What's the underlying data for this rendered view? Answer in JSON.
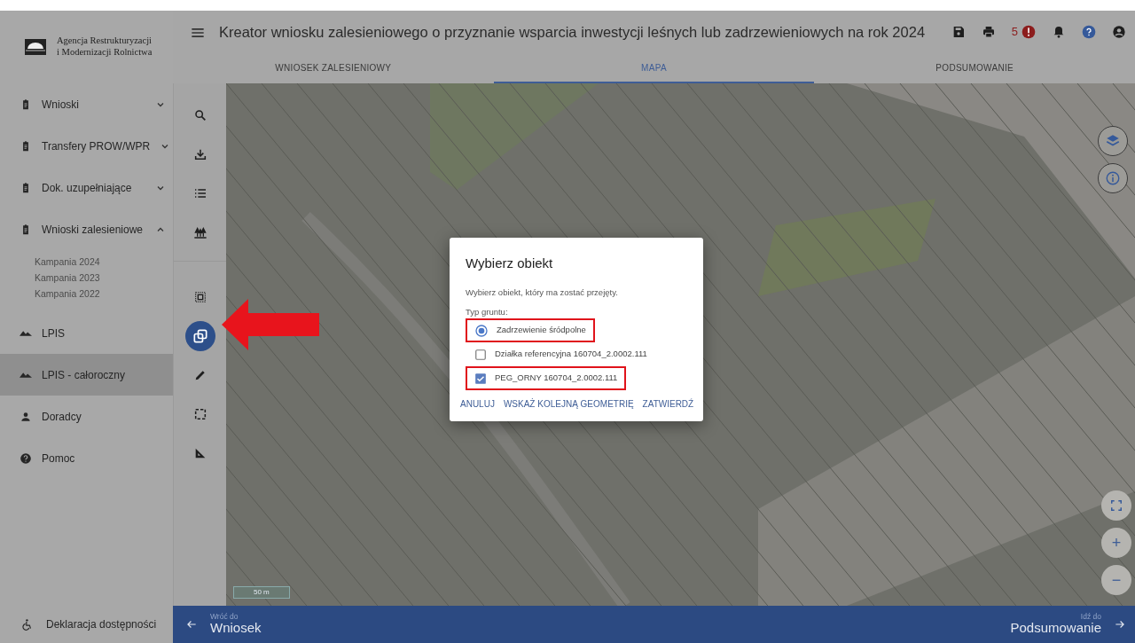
{
  "logo": {
    "line1": "Agencja Restrukturyzacji",
    "line2": "i Modernizacji Rolnictwa"
  },
  "header": {
    "title": "Kreator wniosku zalesieniowego o przyznanie wsparcia inwestycji leśnych lub zadrzewieniowych na rok 2024",
    "error_count": "5"
  },
  "tabs": [
    {
      "label": "WNIOSEK ZALESIENIOWY",
      "selected": false
    },
    {
      "label": "MAPA",
      "selected": true
    },
    {
      "label": "PODSUMOWANIE",
      "selected": false
    }
  ],
  "sidebar": {
    "items": [
      {
        "kind": "clipboard",
        "label": "Wnioski",
        "expanded": false,
        "selected": false
      },
      {
        "kind": "clipboard",
        "label": "Transfery PROW/WPR",
        "expanded": false,
        "selected": false
      },
      {
        "kind": "clipboard",
        "label": "Dok. uzupełniające",
        "expanded": false,
        "selected": false
      },
      {
        "kind": "clipboard",
        "label": "Wnioski zalesieniowe",
        "expanded": true,
        "selected": false,
        "children": [
          {
            "label": "Kampania 2024"
          },
          {
            "label": "Kampania 2023"
          },
          {
            "label": "Kampania 2022"
          }
        ]
      },
      {
        "kind": "mountains",
        "label": "LPIS",
        "selected": false
      },
      {
        "kind": "mountains",
        "label": "LPIS - całoroczny",
        "selected": true
      },
      {
        "kind": "person",
        "label": "Doradcy",
        "selected": false
      },
      {
        "kind": "help",
        "label": "Pomoc",
        "selected": false
      }
    ],
    "footer": {
      "label": "Deklaracja dostępności"
    }
  },
  "tools": [
    {
      "kind": "search",
      "selected": false
    },
    {
      "kind": "download",
      "selected": false
    },
    {
      "kind": "list",
      "selected": false
    },
    {
      "kind": "trees",
      "selected": false
    },
    {
      "kind": "select-area",
      "selected": false
    },
    {
      "kind": "copy",
      "selected": true
    },
    {
      "kind": "pencil",
      "selected": false
    },
    {
      "kind": "rectangle",
      "selected": false
    },
    {
      "kind": "ruler",
      "selected": false
    }
  ],
  "map": {
    "scale": "50 m",
    "controls": [
      {
        "kind": "layers"
      },
      {
        "kind": "info"
      }
    ],
    "zoom_controls": [
      {
        "kind": "fullscreen"
      },
      {
        "kind": "zoom-in",
        "label": "+"
      },
      {
        "kind": "zoom-out",
        "label": "−"
      }
    ]
  },
  "dialog": {
    "title": "Wybierz obiekt",
    "description": "Wybierz obiekt, który ma zostać przejęty.",
    "group_label": "Typ gruntu:",
    "options": [
      {
        "kind": "radio",
        "label": "Zadrzewienie śródpolne",
        "checked": true,
        "highlighted": true
      },
      {
        "kind": "checkbox",
        "label": "Działka referencyjna 160704_2.0002.111",
        "checked": false,
        "highlighted": false
      },
      {
        "kind": "checkbox",
        "label": "PEG_ORNY 160704_2.0002.111",
        "checked": true,
        "highlighted": true
      }
    ],
    "buttons": [
      "ANULUJ",
      "WSKAŻ KOLEJNĄ GEOMETRIĘ",
      "ZATWIERDŹ"
    ]
  },
  "bottom_bar": {
    "back": {
      "caption": "Wróć do",
      "label": "Wniosek"
    },
    "next": {
      "caption": "Idź do",
      "label": "Podsumowanie"
    }
  }
}
